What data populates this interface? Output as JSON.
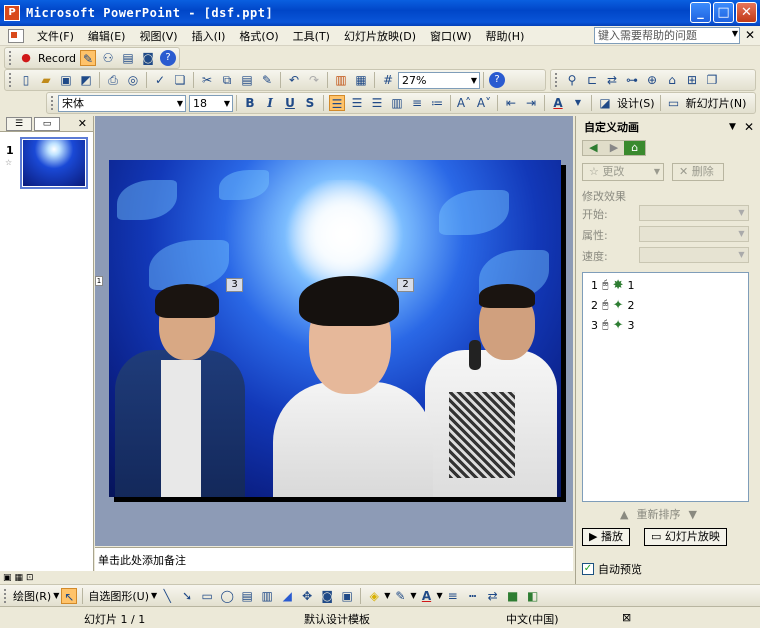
{
  "window": {
    "title": "Microsoft PowerPoint - [dsf.ppt]",
    "app_icon_letter": "P"
  },
  "menu": {
    "items": [
      "文件(F)",
      "编辑(E)",
      "视图(V)",
      "插入(I)",
      "格式(O)",
      "工具(T)",
      "幻灯片放映(D)",
      "窗口(W)",
      "帮助(H)"
    ],
    "help_placeholder": "键入需要帮助的问题"
  },
  "record_toolbar": {
    "record_label": "Record"
  },
  "standard_toolbar": {
    "zoom": "27%"
  },
  "format_toolbar": {
    "font": "宋体",
    "size": "18",
    "bold": "B",
    "italic": "I",
    "underline": "U",
    "shadow": "S",
    "design_label": "设计(S)",
    "new_slide_label": "新幻灯片(N)"
  },
  "slides_pane": {
    "slide_number": "1"
  },
  "slide": {
    "tag_left": "3",
    "tag_right": "2",
    "marker": "1"
  },
  "notes": {
    "placeholder": "单击此处添加备注"
  },
  "task_pane": {
    "title": "自定义动画",
    "change_label": "更改",
    "delete_label": "删除",
    "modify_effect": "修改效果",
    "start_label": "开始:",
    "property_label": "属性:",
    "speed_label": "速度:",
    "items": [
      {
        "order": "1",
        "name": "1"
      },
      {
        "order": "2",
        "name": "2"
      },
      {
        "order": "3",
        "name": "3"
      }
    ],
    "reorder_label": "重新排序",
    "play_label": "播放",
    "slideshow_label": "幻灯片放映",
    "autopreview_label": "自动预览"
  },
  "draw_toolbar": {
    "draw_label": "绘图(R)",
    "autoshape_label": "自选图形(U)"
  },
  "status": {
    "slide": "幻灯片 1 / 1",
    "template": "默认设计模板",
    "language": "中文(中国)"
  }
}
